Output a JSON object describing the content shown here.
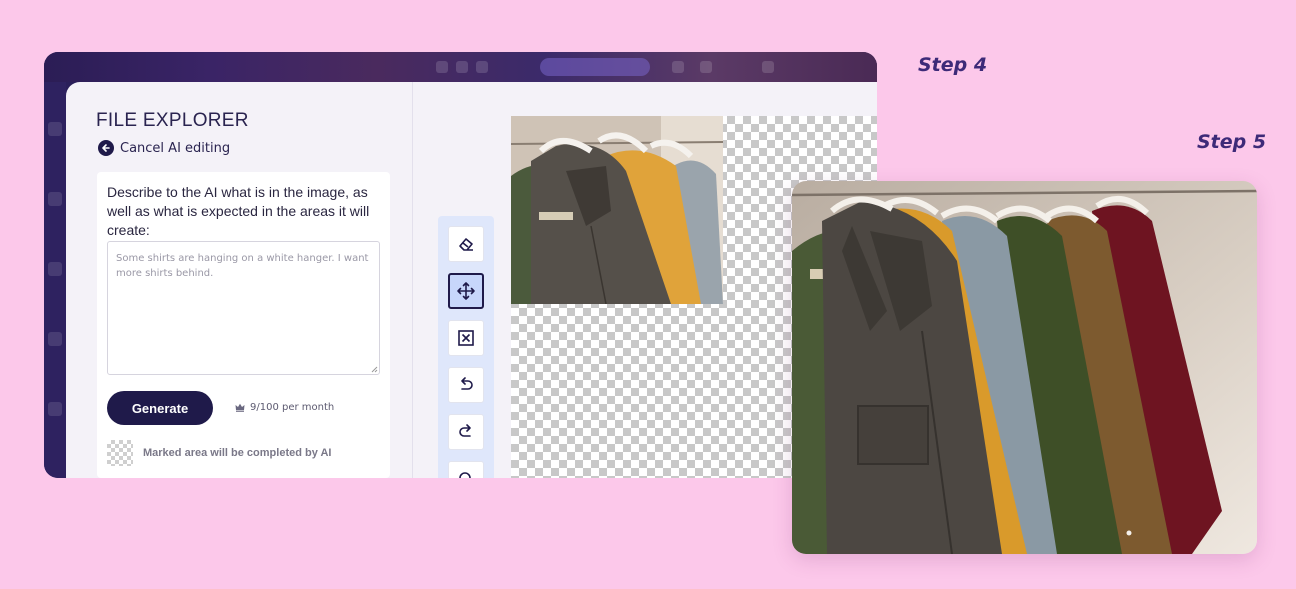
{
  "labels": {
    "step4": "Step 4",
    "step5": "Step 5"
  },
  "explorer": {
    "title": "FILE EXPLORER",
    "cancel_label": "Cancel AI editing",
    "prompt_label": "Describe to the AI what is in the image, as well as what is expected in the areas it will create:",
    "textarea_value": "Some shirts are hanging on a white hanger. I want more shirts behind.",
    "generate_label": "Generate",
    "quota_text": "9/100 per month",
    "marked_label": "Marked area will be completed by AI"
  },
  "toolbar": {
    "tools": [
      {
        "icon": "eraser-icon",
        "active": false
      },
      {
        "icon": "move-icon",
        "active": true
      },
      {
        "icon": "clear-selection-icon",
        "active": false
      },
      {
        "icon": "undo-icon",
        "active": false
      },
      {
        "icon": "redo-icon",
        "active": false
      },
      {
        "icon": "zoom-icon",
        "active": false
      }
    ]
  },
  "colors": {
    "background": "#fcc8ea",
    "primary": "#1f1a4a",
    "step_label": "#3d2a78",
    "active_tool": "#c7d6fb"
  }
}
